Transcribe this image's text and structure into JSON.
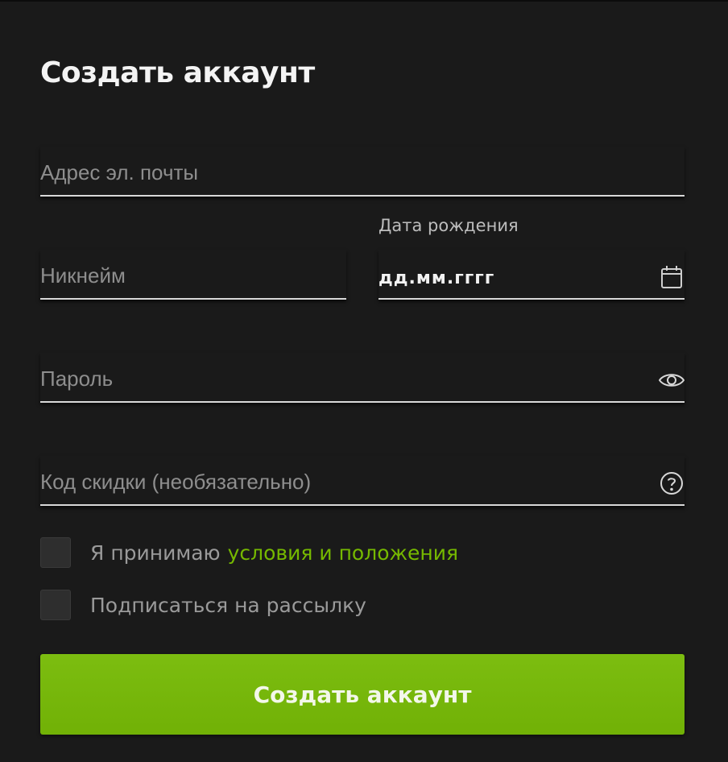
{
  "form": {
    "title": "Создать аккаунт",
    "email": {
      "placeholder": "Адрес эл. почты",
      "value": ""
    },
    "nickname": {
      "placeholder": "Никнейм",
      "value": ""
    },
    "birthdate": {
      "label": "Дата рождения",
      "value": "дд.мм.гггг",
      "icon": "calendar-icon"
    },
    "password": {
      "placeholder": "Пароль",
      "value": "",
      "icon": "eye-icon"
    },
    "discount": {
      "placeholder": "Код скидки (необязательно)",
      "value": "",
      "icon": "help-circle-icon"
    },
    "terms": {
      "text": "Я принимаю",
      "link": "условия и положения",
      "checked": false
    },
    "newsletter": {
      "text": "Подписаться на рассылку",
      "checked": false
    },
    "submit_label": "Создать аккаунт"
  },
  "colors": {
    "background": "#1a1a1a",
    "accent": "#76b900",
    "field_line": "#d8d8d8",
    "placeholder": "#8e8e8e"
  }
}
